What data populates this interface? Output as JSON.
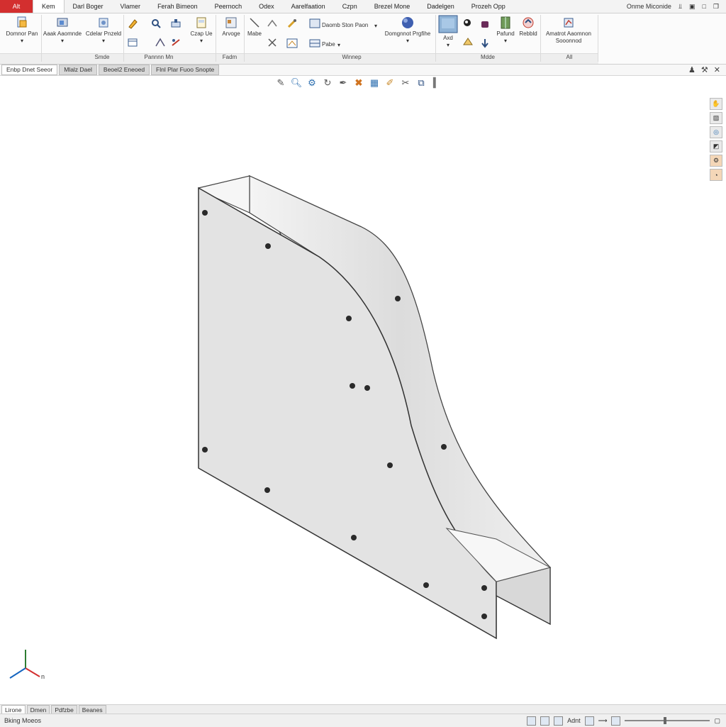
{
  "menu": {
    "app_button": "Alt",
    "tabs": [
      "Kem",
      "Darl Boger",
      "Vlamer",
      "Ferah Bimeon",
      "Peernoch",
      "Odex",
      "Aarelfaation",
      "Czpn",
      "Brezel Mone",
      "Dadelgen",
      "Prozeh Opp"
    ],
    "active_tab_index": 0,
    "user_label": "Onme Miconide"
  },
  "ribbon": {
    "buttons": {
      "b1": "Domnor Pan",
      "b2": "Aaak Aaomnde",
      "b3": "Cdelar Pnzeld",
      "b4": "Czap Ue",
      "b5": "Arvoge",
      "b6": "Mabe",
      "b7": "Daomb Ston Paon",
      "b8": "Pabe",
      "b9": "Domgnnot Prgfihe",
      "b10": "Axd",
      "b11": "Pafund",
      "b12": "Rebbld",
      "b13": "Amatrot Aaomnon Sooonnod"
    },
    "groups": [
      "Smde",
      "Pannnn Mn",
      "Fadm",
      "Winnep",
      "Mdde",
      "All"
    ]
  },
  "doc_tabs": [
    "Enbp Dnet Seeor",
    "Mlalz Dael",
    "Beoel2 Eneoed",
    "Flnl Plar Fuoo Snopte"
  ],
  "bottom_tabs": [
    "Lirone",
    "Dmen",
    "Pdfzbe",
    "Beanes"
  ],
  "status": {
    "message": "Bking Moeos",
    "mode": "Adnt"
  },
  "colors": {
    "app_button": "#d32f2f",
    "axis_x": "#d32f2f",
    "axis_y": "#2e7d32",
    "axis_z": "#1565c0"
  },
  "icons": {
    "viewbar": [
      "pencil-icon",
      "zoom-icon",
      "gear-icon",
      "rotate-icon",
      "pen-icon",
      "close-x-icon",
      "grid-icon",
      "brush-icon",
      "cut-icon",
      "export-icon",
      "panel-icon"
    ],
    "sidebar": [
      "pan-icon",
      "image-icon",
      "globe-icon",
      "layers-icon",
      "settings-icon",
      "orbit-icon"
    ]
  },
  "axis_labels": {
    "x": "n"
  }
}
